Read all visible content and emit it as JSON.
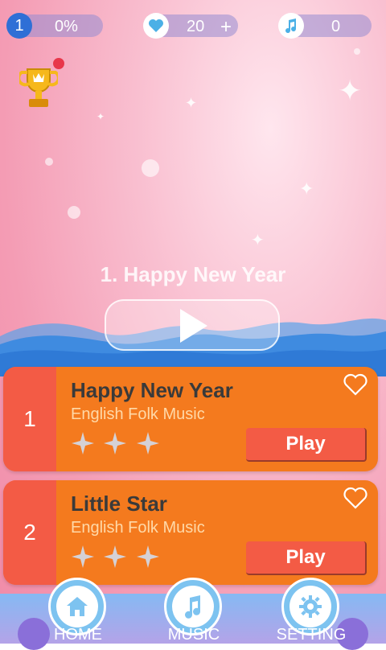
{
  "top_bar": {
    "level": "1",
    "progress": "0%",
    "hearts": "20",
    "plus": "+",
    "notes": "0"
  },
  "current_song": {
    "title": "1. Happy New Year"
  },
  "songs": [
    {
      "rank": "1",
      "name": "Happy New Year",
      "artist": "English Folk Music",
      "stars": 3,
      "play_label": "Play"
    },
    {
      "rank": "2",
      "name": "Little Star",
      "artist": "English Folk Music",
      "stars": 3,
      "play_label": "Play"
    }
  ],
  "nav": {
    "home": "HOME",
    "music": "MUSIC",
    "setting": "SETTING"
  },
  "colors": {
    "accent": "#f47a1e",
    "rank_bg": "#f35b45",
    "level_badge": "#2f6fd6"
  },
  "icons": [
    "trophy-icon",
    "heart-icon",
    "music-note-icon",
    "play-icon",
    "star-icon",
    "home-icon",
    "gear-icon"
  ]
}
